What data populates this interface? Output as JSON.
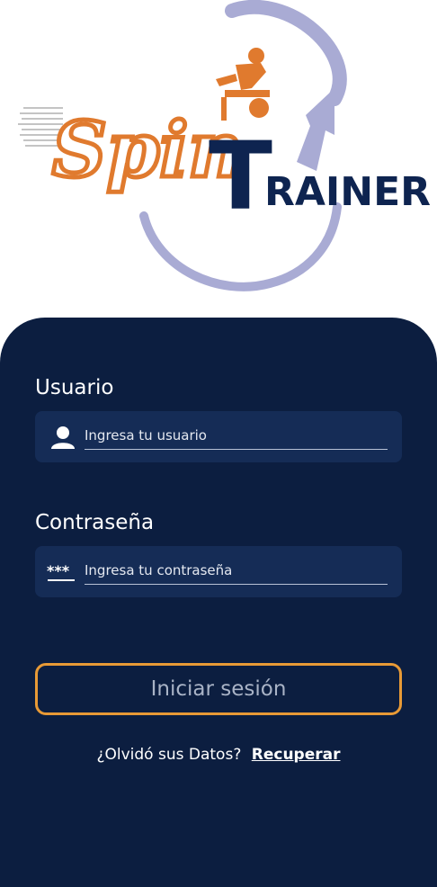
{
  "logo": {
    "word_spin": "Spin",
    "word_trainer": "TRAINER",
    "colors": {
      "orange": "#e07a2e",
      "navy": "#0e2450",
      "swoosh": "#a9abd4"
    }
  },
  "form": {
    "username_label": "Usuario",
    "username_placeholder": "Ingresa tu usuario",
    "password_label": "Contraseña",
    "password_placeholder": "Ingresa tu contraseña",
    "login_button": "Iniciar sesión"
  },
  "recovery": {
    "prompt": "¿Olvidó sus Datos?",
    "link": "Recuperar"
  },
  "theme": {
    "panel_bg": "#0c1e40",
    "field_bg": "#152c56",
    "button_border": "#e89a36"
  }
}
